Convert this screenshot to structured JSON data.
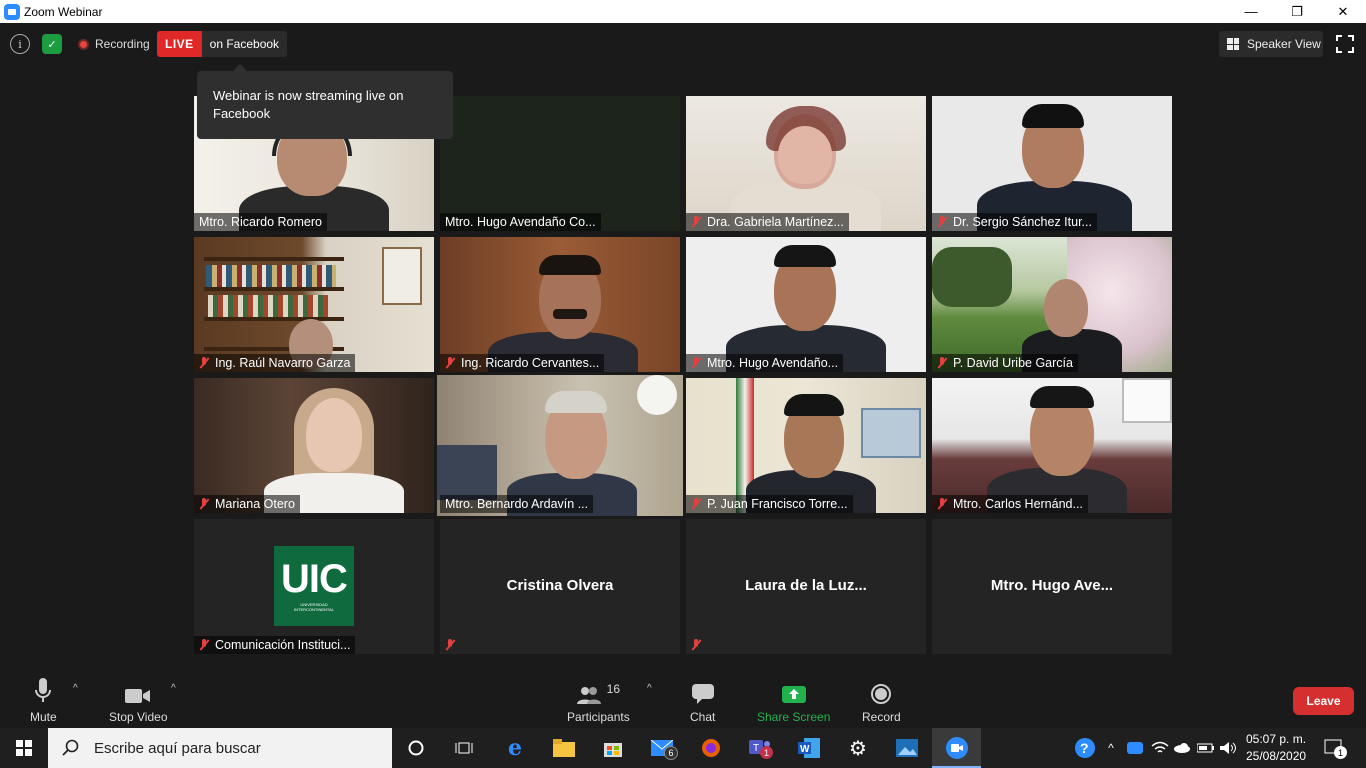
{
  "window": {
    "title": "Zoom Webinar"
  },
  "topbar": {
    "recording_label": "Recording",
    "live_badge": "LIVE",
    "live_platform": "on Facebook",
    "speaker_view_label": "Speaker View"
  },
  "tooltip": {
    "text": "Webinar is now streaming live on Facebook"
  },
  "participants": [
    {
      "name": "Mtro. Ricardo Romero",
      "muted": false
    },
    {
      "name": "Mtro. Hugo Avendaño Co...",
      "muted": false
    },
    {
      "name": "Dra. Gabriela Martínez...",
      "muted": true
    },
    {
      "name": "Dr. Sergio Sánchez Itur...",
      "muted": true
    },
    {
      "name": "Ing. Raúl Navarro Garza",
      "muted": true
    },
    {
      "name": "Ing. Ricardo Cervantes...",
      "muted": true
    },
    {
      "name": "Mtro. Hugo Avendaño...",
      "muted": true
    },
    {
      "name": "P. David Uribe García",
      "muted": true
    },
    {
      "name": "Mariana Otero",
      "muted": true
    },
    {
      "name": "Mtro. Bernardo Ardavín ...",
      "muted": false,
      "active_speaker": true
    },
    {
      "name": "P. Juan Francisco Torre...",
      "muted": true
    },
    {
      "name": "Mtro. Carlos Hernánd...",
      "muted": true
    },
    {
      "name": "Comunicación Instituci...",
      "muted": true,
      "logo_text": "UIC",
      "logo_sub": "UNIVERSIDAD INTERCONTINENTAL"
    },
    {
      "name": "",
      "center_name": "Cristina Olvera",
      "muted": true
    },
    {
      "name": "",
      "center_name": "Laura de la Luz...",
      "muted": true
    },
    {
      "name": "",
      "center_name": "Mtro. Hugo Ave...",
      "muted": false
    }
  ],
  "toolbar": {
    "mute_label": "Mute",
    "stop_video_label": "Stop Video",
    "participants_label": "Participants",
    "participants_count": "16",
    "chat_label": "Chat",
    "share_screen_label": "Share Screen",
    "record_label": "Record",
    "leave_label": "Leave"
  },
  "taskbar": {
    "search_placeholder": "Escribe aquí para buscar",
    "mail_badge": "6",
    "teams_badge": "1",
    "time": "05:07 p. m.",
    "date": "25/08/2020",
    "notification_count": "1"
  },
  "colors": {
    "accent": "#2d8cff",
    "live": "#e02828",
    "share_green": "#23b14d",
    "leave": "#d62f2f",
    "active_border": "#c7e34a"
  }
}
